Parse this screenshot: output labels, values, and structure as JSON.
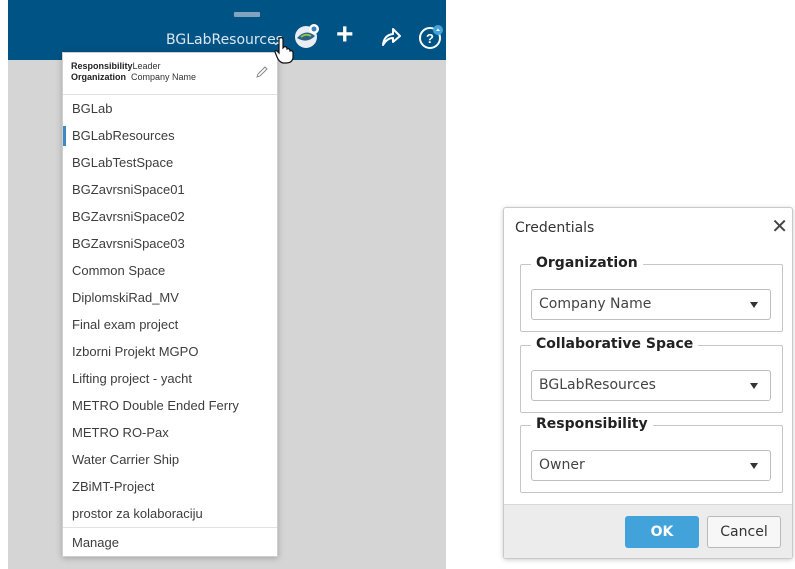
{
  "topbar": {
    "tenant_label": "BGLabResources",
    "tenant_caret": "⌄",
    "add_label": "+"
  },
  "dropdown": {
    "responsibility_key": "Responsibility",
    "responsibility_value": "Leader",
    "organization_key": "Organization",
    "organization_value": "Company Name",
    "items": [
      "BGLab",
      "BGLabResources",
      "BGLabTestSpace",
      "BGZavrsniSpace01",
      "BGZavrsniSpace02",
      "BGZavrsniSpace03",
      "Common Space",
      "DiplomskiRad_MV",
      "Final exam project",
      "Izborni Projekt MGPO",
      "Lifting project - yacht",
      "METRO Double Ended Ferry",
      "METRO RO-Pax",
      "Water Carrier Ship",
      "ZBiMT-Project",
      "prostor za kolaboraciju"
    ],
    "active_item": "BGLabResources",
    "manage_label": "Manage"
  },
  "dialog": {
    "title": "Credentials",
    "close_glyph": "✕",
    "organization": {
      "legend": "Organization",
      "value": "Company Name"
    },
    "space": {
      "legend": "Collaborative Space",
      "value": "BGLabResources"
    },
    "responsibility": {
      "legend": "Responsibility",
      "value": "Owner"
    },
    "ok_label": "OK",
    "cancel_label": "Cancel"
  },
  "colors": {
    "topbar": "#005385",
    "accent": "#42a2da",
    "active_marker": "#3d8ac4"
  },
  "icons": [
    "compass-icon",
    "plus-icon",
    "share-icon",
    "help-icon",
    "edit-icon",
    "close-icon",
    "hand-cursor-icon",
    "chevron-down-icon"
  ]
}
